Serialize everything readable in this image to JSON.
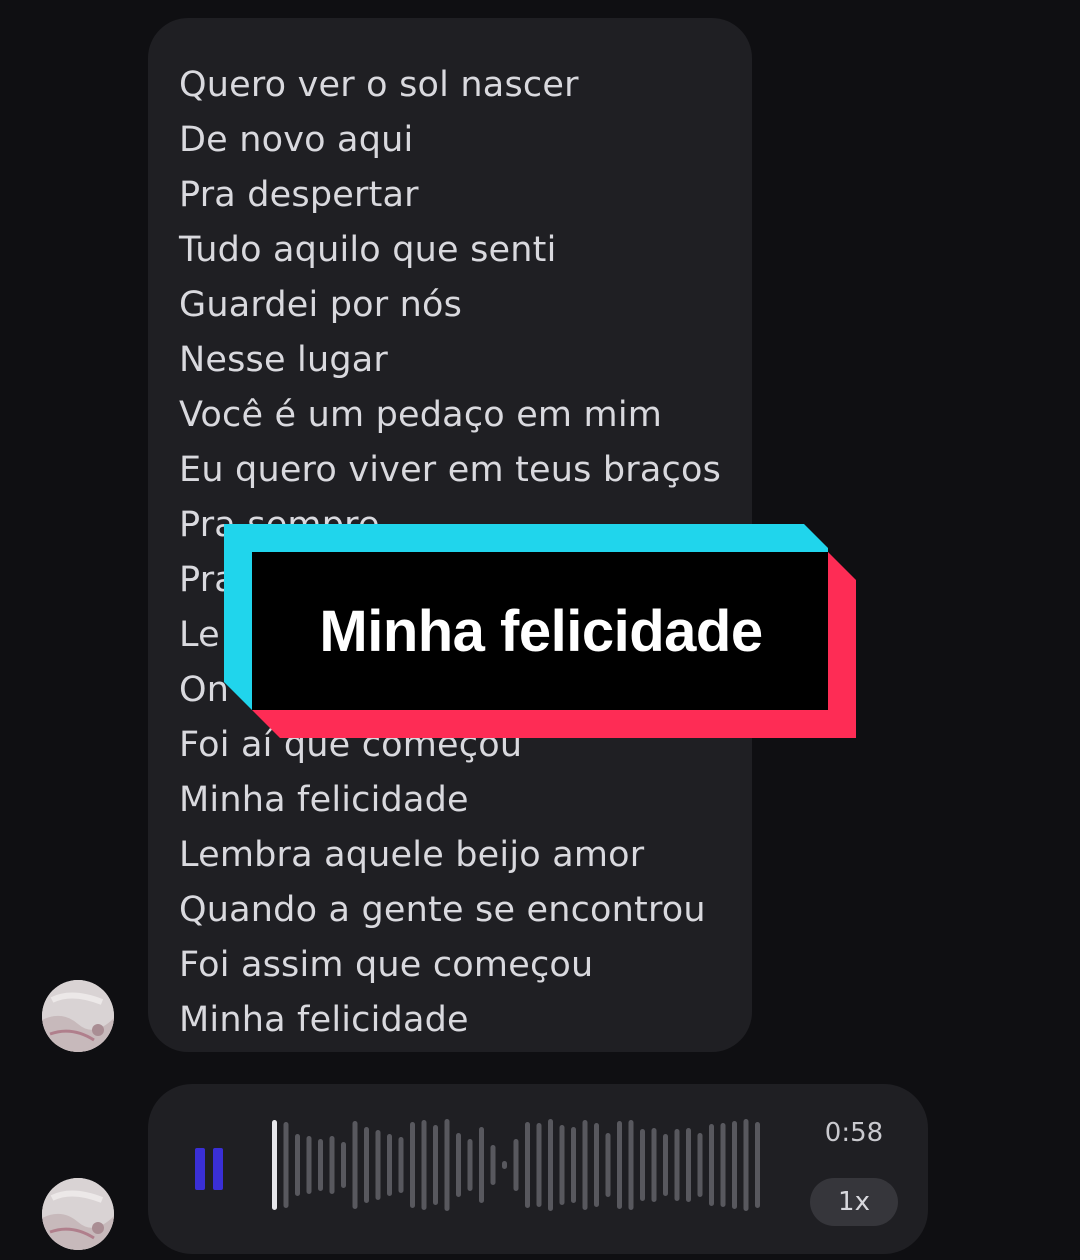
{
  "lyrics": [
    "Quero ver o sol nascer",
    "De novo aqui",
    "Pra despertar",
    "Tudo aquilo que senti",
    "Guardei por nós",
    "Nesse lugar",
    "Você é um pedaço em mim",
    "Eu quero viver em teus braços",
    "Pra sempre",
    "Pra",
    "Le",
    "On",
    "Foi aí que começou",
    "Minha felicidade",
    "Lembra aquele beijo amor",
    "Quando a gente se encontrou",
    "Foi assim que começou",
    "Minha felicidade"
  ],
  "caption": {
    "text": "Minha felicidade"
  },
  "audio": {
    "duration": "0:58",
    "speed": "1x",
    "state": "playing",
    "progress": 0.02
  },
  "colors": {
    "background": "#0f0f12",
    "bubble": "#1f1f23",
    "lyric_text": "#d9d9de",
    "caption_cyan": "#20d5ec",
    "caption_red": "#fe2c55",
    "caption_black": "#000000",
    "pause_icon": "#3a2fd6",
    "waveform_played": "#e6e6ea",
    "waveform_unplayed": "#58585e"
  },
  "icons": {
    "pause": "pause-icon",
    "avatar": "avatar-photo"
  }
}
